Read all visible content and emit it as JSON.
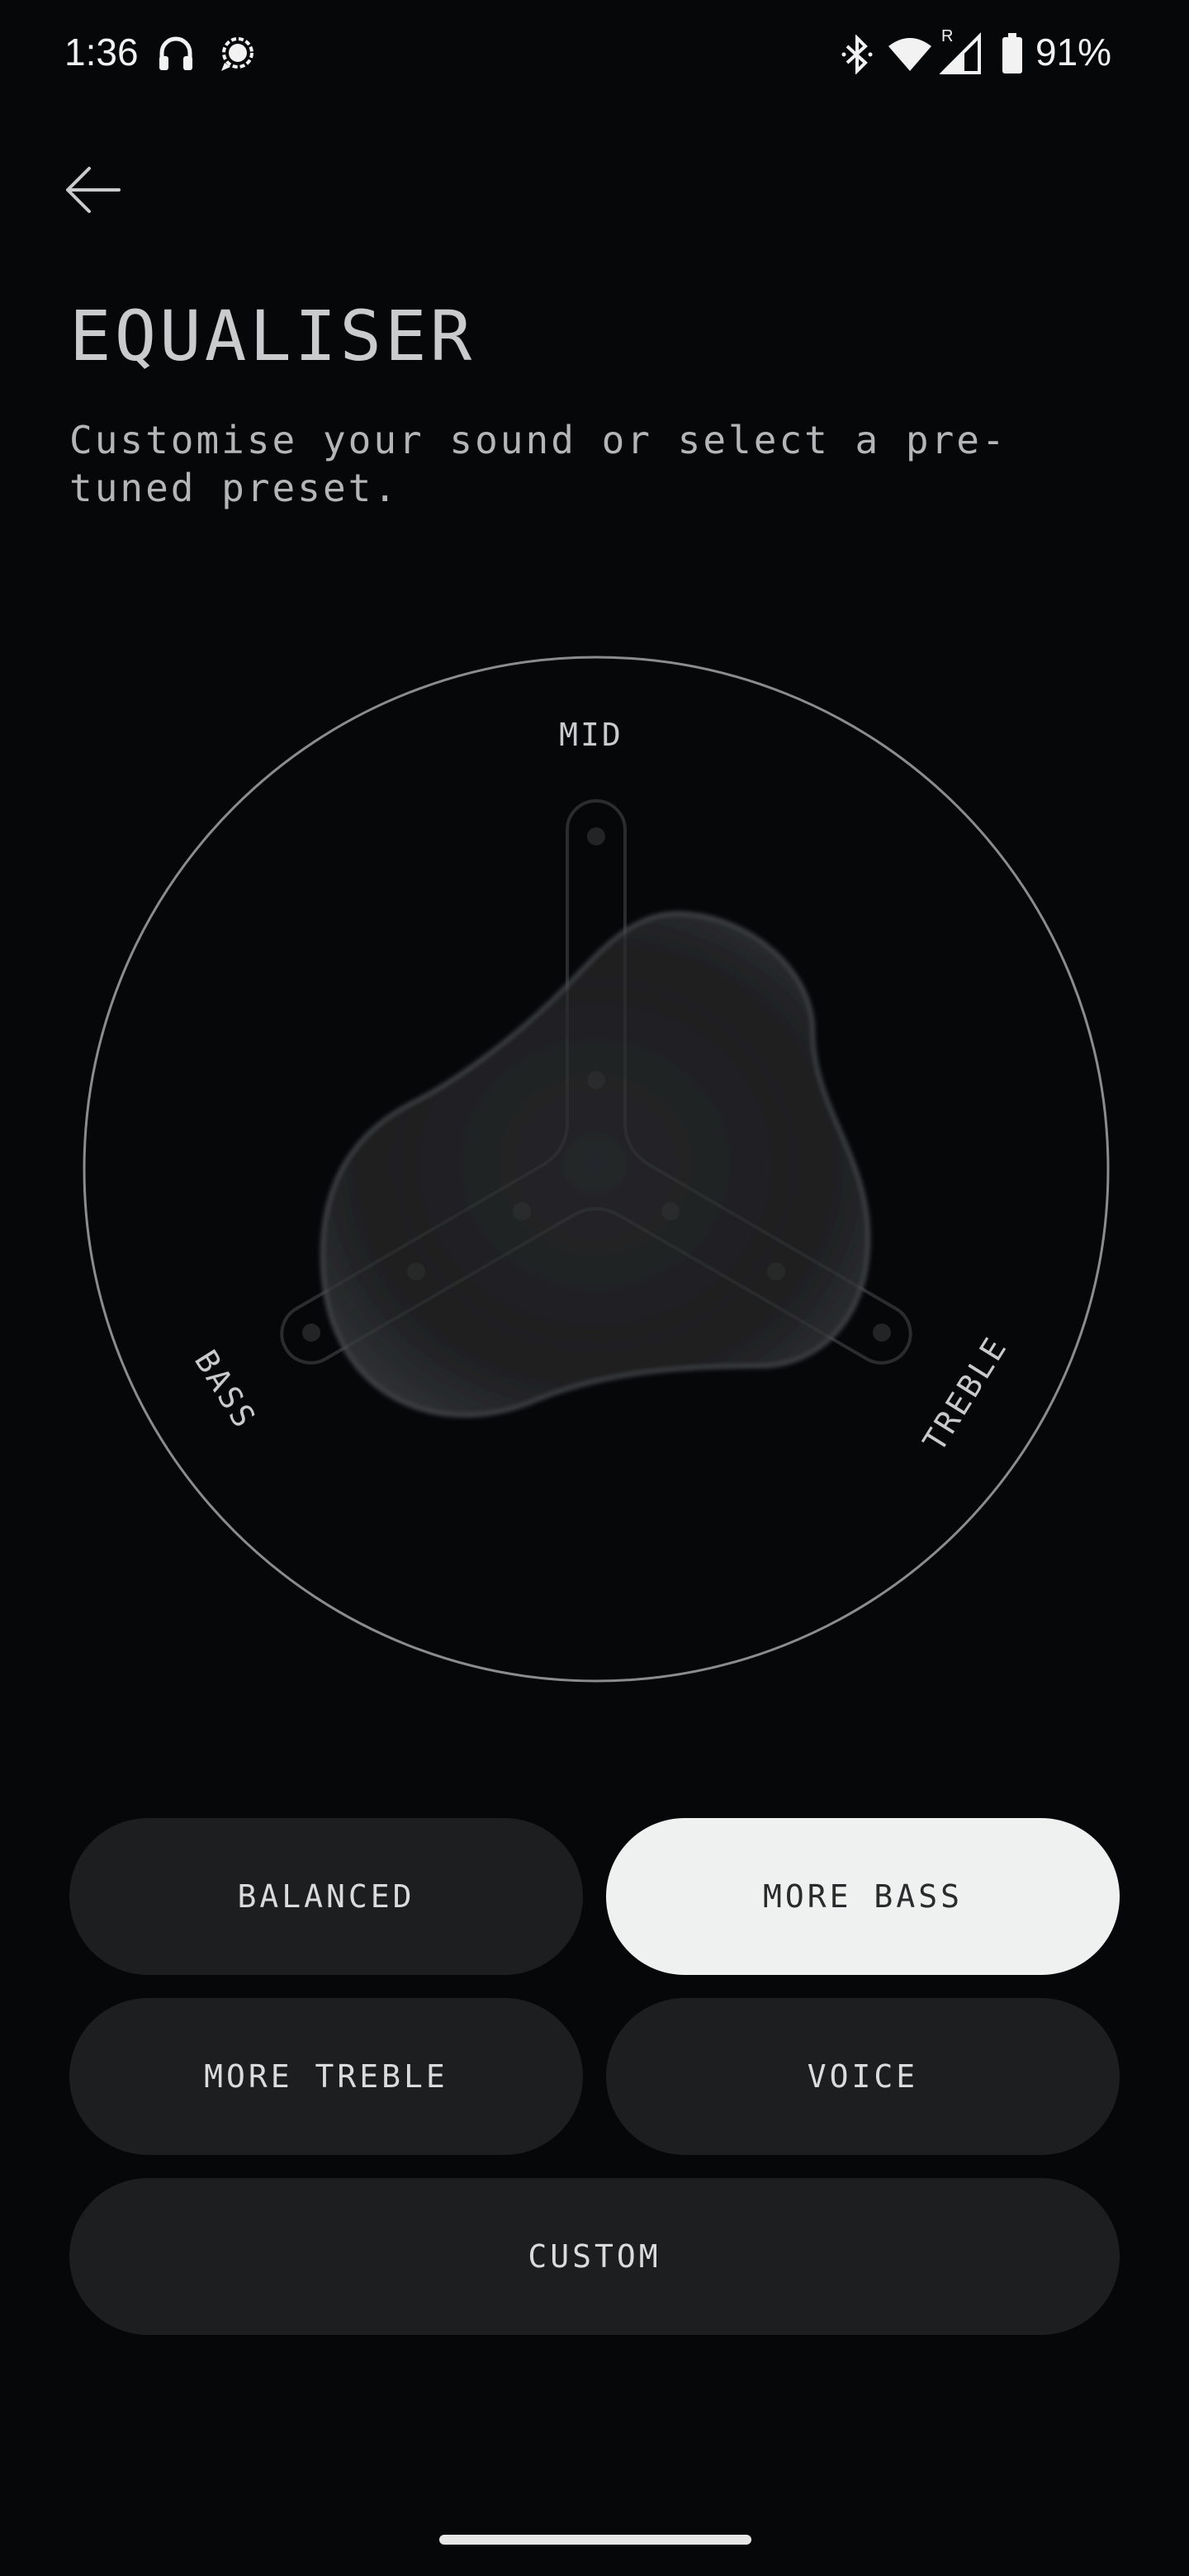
{
  "status_bar": {
    "time": "1:36",
    "battery_percent": "91%",
    "icons": [
      "headphones-icon",
      "chat-bubble-icon",
      "bluetooth-icon",
      "wifi-icon",
      "cellular-roaming-icon",
      "battery-icon"
    ],
    "roaming_marker": "R"
  },
  "header": {
    "back_icon": "arrow-left-icon",
    "title": "EQUALISER",
    "subtitle": "Customise your sound or select a pre-tuned preset."
  },
  "equaliser": {
    "axes": {
      "mid": "MID",
      "bass": "BASS",
      "treble": "TREBLE"
    },
    "levels": {
      "bass": 0.9,
      "mid": 0.35,
      "treble": 0.65
    }
  },
  "presets": {
    "items": [
      {
        "label": "BALANCED",
        "selected": false
      },
      {
        "label": "MORE BASS",
        "selected": true
      },
      {
        "label": "MORE TREBLE",
        "selected": false
      },
      {
        "label": "VOICE",
        "selected": false
      },
      {
        "label": "CUSTOM",
        "selected": false
      }
    ]
  },
  "colors": {
    "background": "#060709",
    "button": "#1d1e20",
    "button_selected": "#eff1f0",
    "text": "#d4d6d8"
  }
}
